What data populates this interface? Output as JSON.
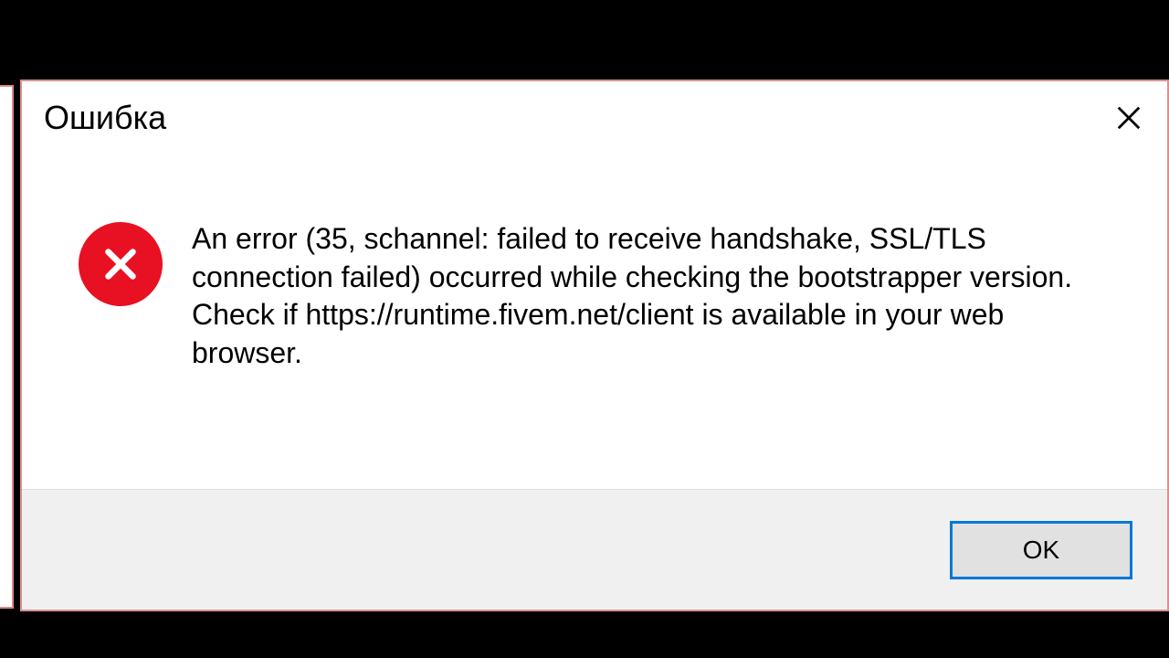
{
  "dialog": {
    "title": "Ошибка",
    "message": "An error (35, schannel: failed to receive handshake, SSL/TLS connection failed) occurred while checking the bootstrapper version. Check if https://runtime.fivem.net/client is available in your web browser.",
    "ok_label": "OK"
  }
}
